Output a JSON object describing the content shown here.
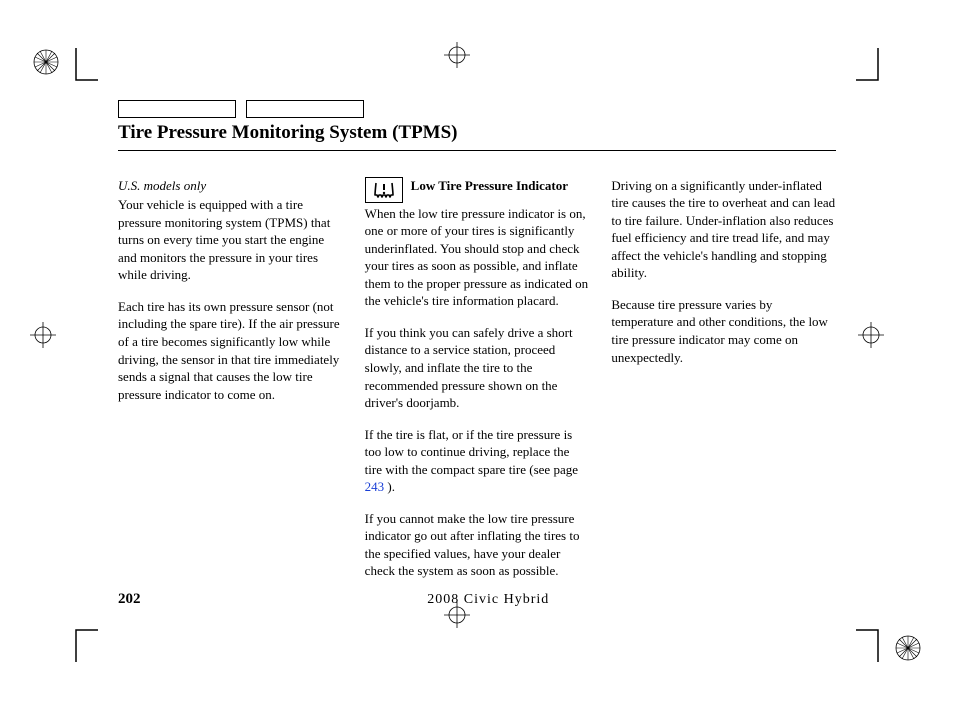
{
  "title": "Tire Pressure Monitoring System (TPMS)",
  "note": "U.S. models only",
  "col1": {
    "p1": "Your vehicle is equipped with a tire pressure monitoring system (TPMS) that turns on every time you start the engine and monitors the pressure in your tires while driving.",
    "p2": "Each tire has its own pressure sensor (not including the spare tire). If the air pressure of a tire becomes significantly low while driving, the sensor in that tire immediately sends a signal that causes the low tire pressure indicator to come on."
  },
  "col2": {
    "subhead": "Low Tire Pressure Indicator",
    "p1": "When the low tire pressure indicator is on, one or more of your tires is significantly underinflated. You should stop and check your tires as soon as possible, and inflate them to the proper pressure as indicated on the vehicle's tire information placard.",
    "p2": "If you think you can safely drive a short distance to a service station, proceed slowly, and inflate the tire to the recommended pressure shown on the driver's doorjamb.",
    "p3a": "If the tire is flat, or if the tire pressure is too low to continue driving, replace the tire with the compact spare tire (see page ",
    "p3link": "243",
    "p3b": " ).",
    "p4": "If you cannot make the low tire pressure indicator go out after inflating the tires to the specified values, have your dealer check the system as soon as possible."
  },
  "col3": {
    "p1": "Driving on a significantly under-inflated tire causes the tire to overheat and can lead to tire failure. Under-inflation also reduces fuel efficiency and tire tread life, and may affect the vehicle's handling and stopping ability.",
    "p2": "Because tire pressure varies by temperature and other conditions, the low tire pressure indicator may come on unexpectedly."
  },
  "footer": {
    "page": "202",
    "model": "2008  Civic  Hybrid"
  }
}
